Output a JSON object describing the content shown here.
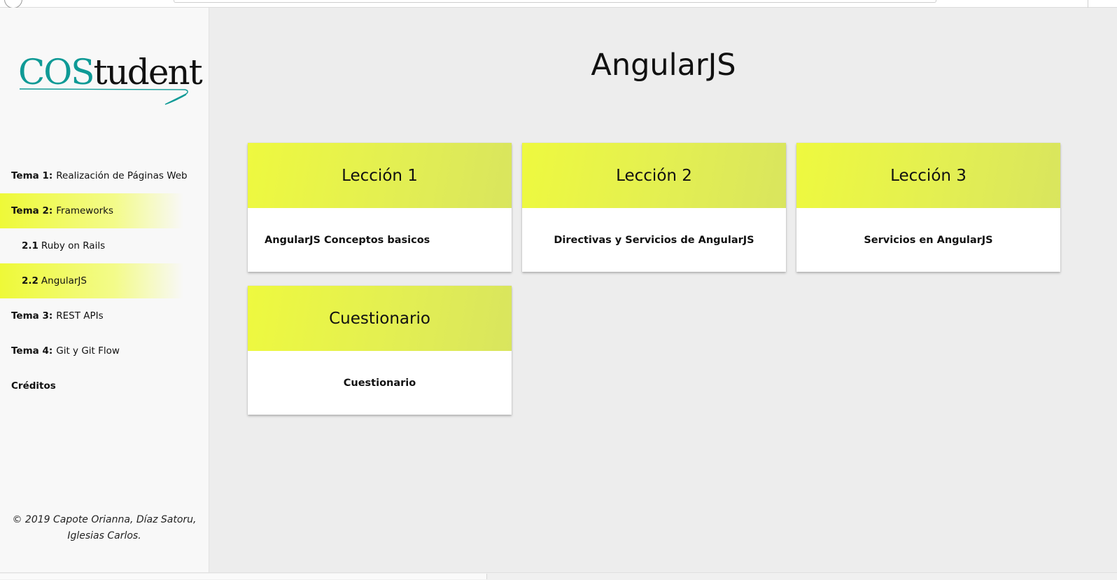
{
  "logo": {
    "part1": "COS",
    "part2": "tudent"
  },
  "sidebar": {
    "items": [
      {
        "num": "Tema 1",
        "sep": ":",
        "label": "Realización de Páginas Web"
      },
      {
        "num": "Tema 2",
        "sep": ":",
        "label": "Frameworks"
      },
      {
        "num": "2.1",
        "sep": "",
        "label": "Ruby on Rails"
      },
      {
        "num": "2.2",
        "sep": "",
        "label": "AngularJS"
      },
      {
        "num": "Tema 3",
        "sep": ":",
        "label": "REST APIs"
      },
      {
        "num": "Tema 4",
        "sep": ":",
        "label": "Git y Git Flow"
      },
      {
        "num": "",
        "sep": "",
        "label": "Créditos"
      }
    ],
    "footer": {
      "line1": "© 2019 Capote Orianna, Díaz Satoru,",
      "line2": "Iglesias Carlos."
    }
  },
  "main": {
    "title": "AngularJS",
    "cards": [
      {
        "header": "Lección 1",
        "body": "AngularJS Conceptos basicos"
      },
      {
        "header": "Lección 2",
        "body": "Directivas y Servicios de AngularJS"
      },
      {
        "header": "Lección 3",
        "body": "Servicios en AngularJS"
      },
      {
        "header": "Cuestionario",
        "body": "Cuestionario"
      }
    ]
  },
  "colors": {
    "accent": "#eef93f",
    "logo_teal": "#0f9a96",
    "background": "#ededed"
  }
}
